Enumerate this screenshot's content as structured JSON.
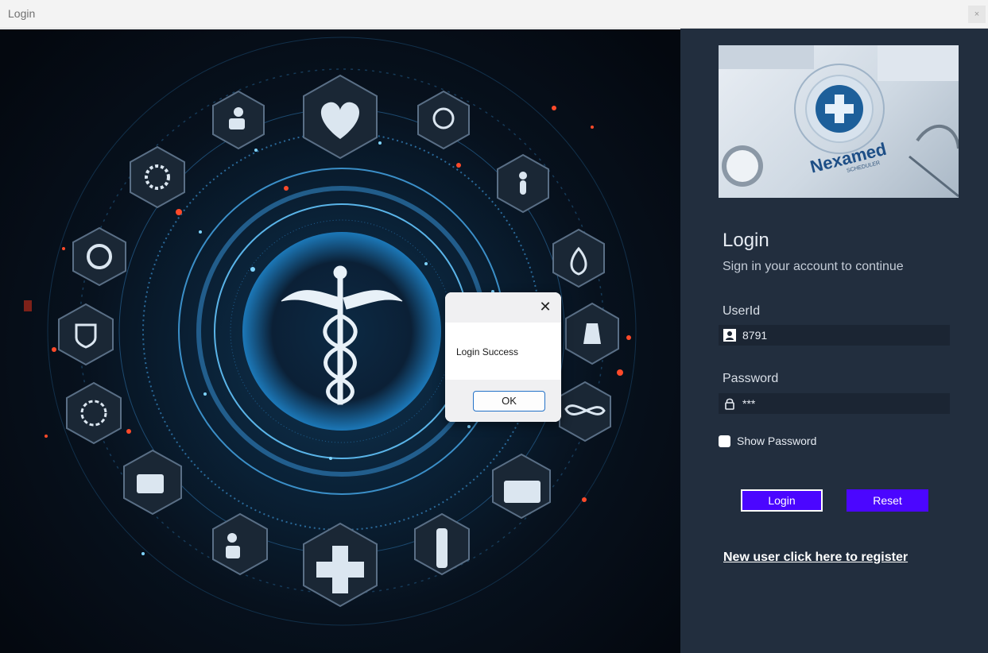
{
  "window": {
    "title": "Login",
    "close_glyph": "×"
  },
  "art": {
    "description_icon": "caduceus-icon"
  },
  "logo": {
    "brand_text": "Nexamed",
    "brand_sub": "SCHEDULER"
  },
  "login": {
    "heading": "Login",
    "subheading": "Sign in your account to continue",
    "userid_label": "UserId",
    "userid_value": "8791",
    "userid_icon": "user-icon",
    "password_label": "Password",
    "password_value": "***",
    "password_icon": "lock-icon",
    "show_password_label": "Show Password",
    "show_password_checked": false,
    "login_button": "Login",
    "reset_button": "Reset",
    "register_link": "New user click here to register"
  },
  "dialog": {
    "message": "Login Success",
    "ok_button": "OK",
    "close_glyph": "✕"
  },
  "colors": {
    "panel_bg": "#222e3e",
    "field_bg": "#1b2533",
    "button_accent": "#4b06ff",
    "dialog_ok_border": "#2472c8"
  }
}
